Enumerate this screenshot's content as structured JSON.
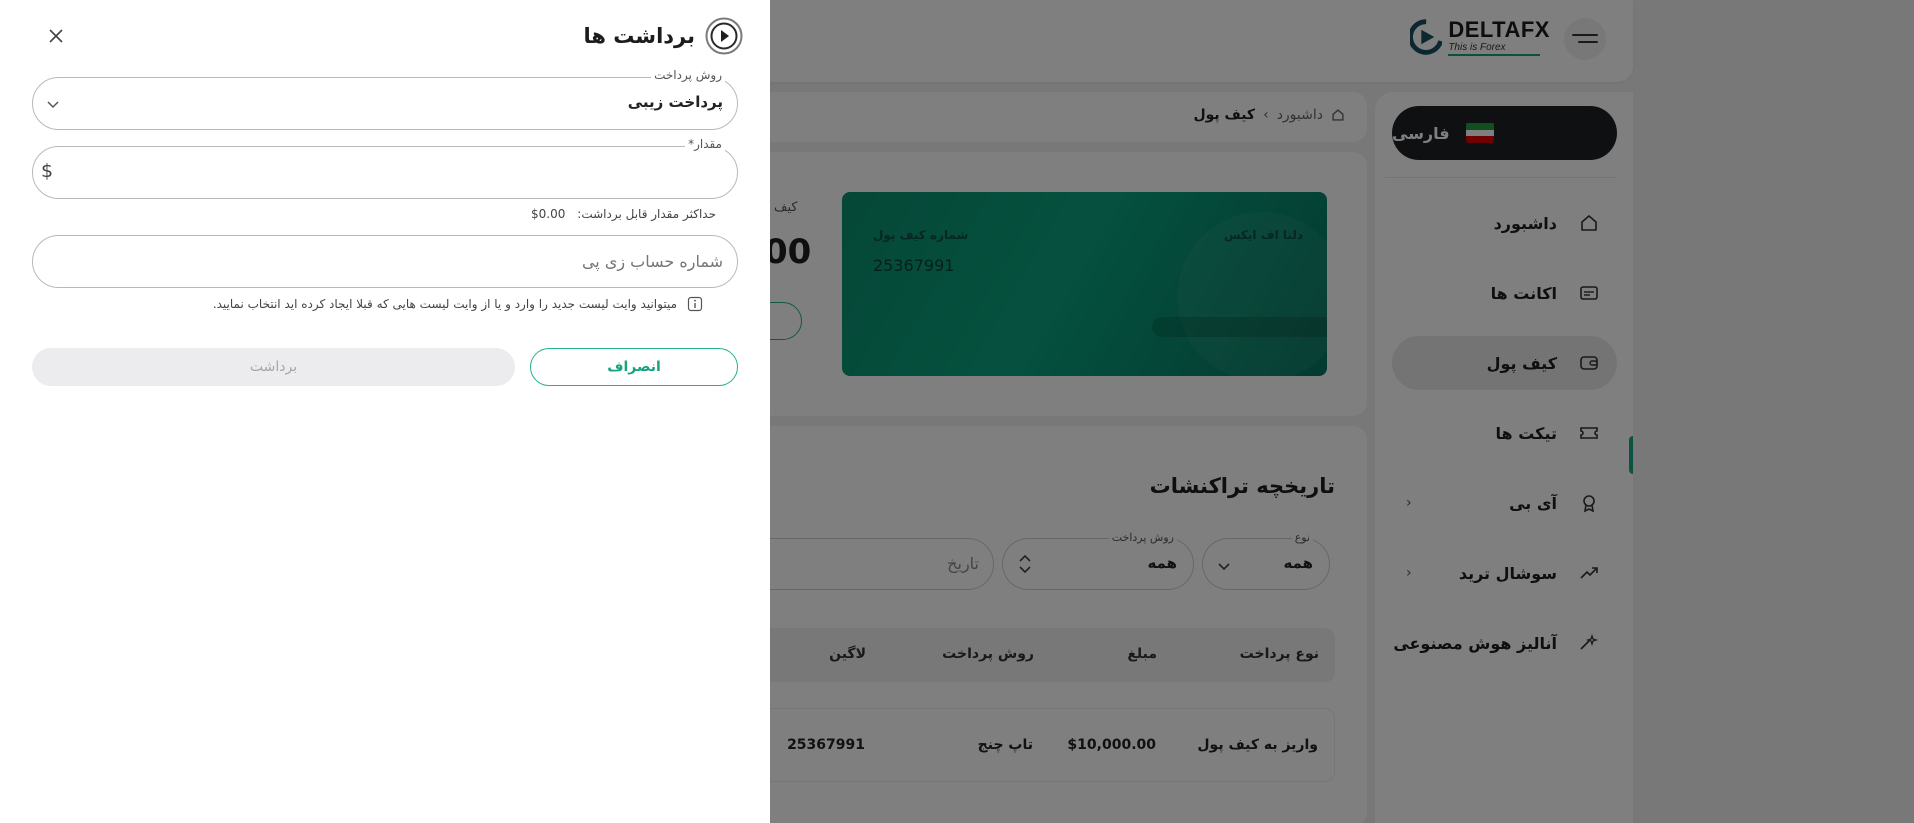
{
  "topbar": {
    "logo_name": "DELTAFX",
    "logo_tagline": "This is Forex"
  },
  "sidebar": {
    "language": "فارسی",
    "items": [
      {
        "label": "داشبورد",
        "icon": "home-icon"
      },
      {
        "label": "اکانت ها",
        "icon": "card-icon"
      },
      {
        "label": "کیف پول",
        "icon": "wallet-icon",
        "active": true
      },
      {
        "label": "تیکت ها",
        "icon": "ticket-icon"
      },
      {
        "label": "آی بی",
        "icon": "badge-icon",
        "has_submenu": true
      },
      {
        "label": "سوشال ترید",
        "icon": "trend-icon",
        "has_submenu": true
      },
      {
        "label": "آنالیز هوش مصنوعی",
        "icon": "sparkle-icon"
      }
    ],
    "chevron": "‹"
  },
  "breadcrumb": {
    "home": "داشبورد",
    "separator": "›",
    "current": "کیف پول"
  },
  "wallet": {
    "card_brand": "دلتا اف ایکس",
    "number_label": "شماره کیف پول",
    "number": "25367991",
    "side_label": "کیف",
    "side_amount": "00"
  },
  "transactions": {
    "title": "تاریخچه تراکنشات",
    "filters": {
      "type_label": "نوع",
      "type_value": "همه",
      "method_label": "روش پرداخت",
      "method_value": "همه",
      "date_placeholder": "تاریخ"
    },
    "columns": [
      "نوع پرداخت",
      "مبلغ",
      "روش پرداخت",
      "لاگین"
    ],
    "rows": [
      [
        "واریز به کیف پول",
        "$10,000.00",
        "تاپ چنج",
        "25367991"
      ]
    ]
  },
  "drawer": {
    "title": "برداشت ها",
    "payment_method_label": "روش پرداخت",
    "payment_method_value": "پرداخت زیبی",
    "amount_label": "*مقدار",
    "currency_symbol": "$",
    "max_label": "حداکثر مقدار قابل برداشت:",
    "max_value": "$0.00",
    "account_placeholder": "شماره حساب زی پی",
    "hint": "میتوانید وایت لیست جدید را وارد و یا از وایت لیست هایی که قبلا ایجاد کرده اید انتخاب نمایید.",
    "cancel_label": "انصراف",
    "withdraw_label": "برداشت"
  },
  "colors": {
    "accent": "#17a887",
    "overlay": "rgba(0,0,0,0.5)",
    "pill_dark": "#1f2023"
  }
}
